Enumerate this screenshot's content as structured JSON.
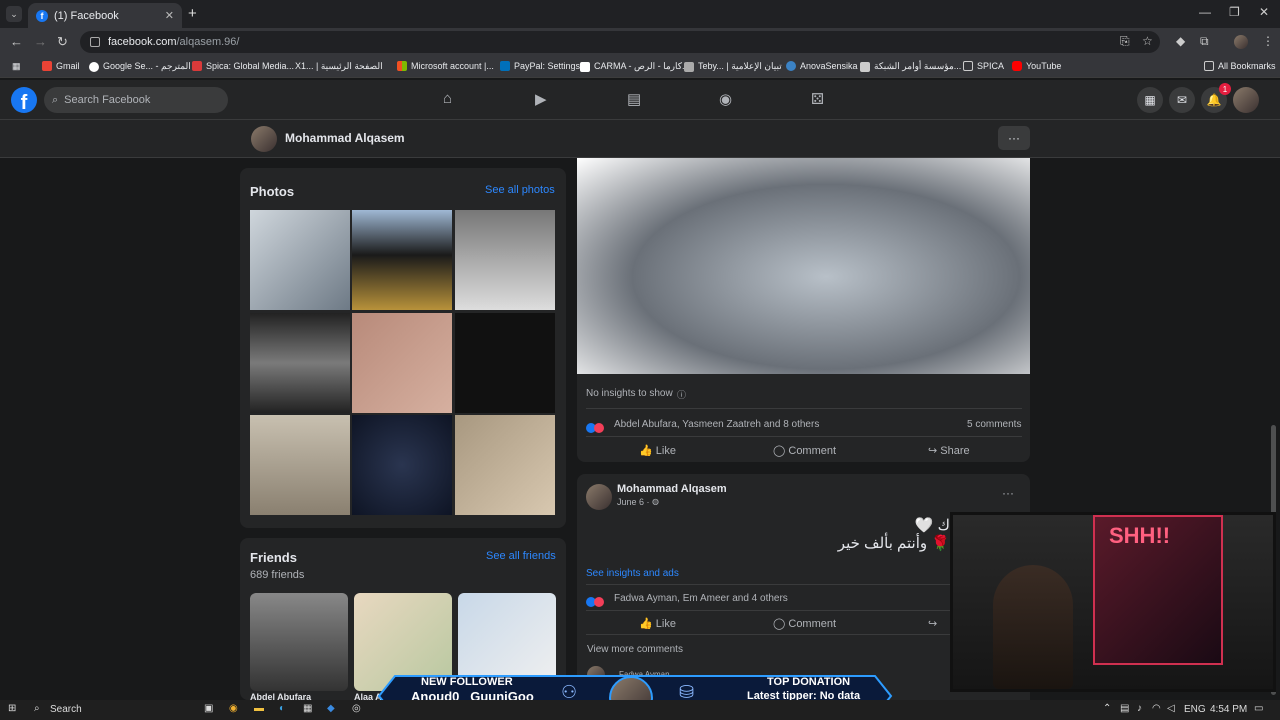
{
  "browser": {
    "tab_title": "(1) Facebook",
    "url_host": "facebook.com",
    "url_path": "/alqasem.96/",
    "bookmarks": [
      "Gmail",
      "Google Se... - المترجم",
      "Spica: Global Media...",
      "X1... | الصفحة الرئيسية",
      "Microsoft account |...",
      "PayPal: Settings",
      "CARMA - كارما - الرص...",
      "Teby... | تبيان الإعلامية",
      "AnovaSensika",
      "مؤسسة أوامر الشبكة...",
      "SPICA",
      "YouTube"
    ],
    "all_bookmarks": "All Bookmarks"
  },
  "fb": {
    "search_placeholder": "Search Facebook",
    "notif_count": "1",
    "profile_name": "Mohammad Alqasem"
  },
  "photos": {
    "title": "Photos",
    "see_all": "See all photos"
  },
  "friends": {
    "title": "Friends",
    "count": "689 friends",
    "see_all": "See all friends",
    "names": [
      "Abdel Abufara",
      "Alaa Al"
    ]
  },
  "post1": {
    "insights": "No insights to show",
    "reactions": "Abdel Abufara, Yasmeen Zaatreh and 8 others",
    "comments": "5 comments",
    "like": "Like",
    "comment": "Comment",
    "share": "Share"
  },
  "post2": {
    "author": "Mohammad Alqasem",
    "date": "June 6 ·",
    "text_line1": "ك 🤍",
    "text_line2": "🌹 وأنتم بألف خير",
    "insights_link": "See insights and ads",
    "reactions": "Fadwa Ayman, Em Ameer and 4 others",
    "like": "Like",
    "comment": "Comment",
    "view_more": "View more comments",
    "commenter": "Fadwa Ayman"
  },
  "overlay": {
    "new_follower_label": "NEW FOLLOWER",
    "new_follower_names": "Anoud0   GuuniGoo",
    "top_donation_label": "TOP DONATION",
    "top_donation_text": "Latest tipper: No data"
  },
  "taskbar": {
    "search": "Search",
    "lang": "ENG",
    "time": "4:54 PM"
  },
  "webcam_sign": "SHH!!"
}
